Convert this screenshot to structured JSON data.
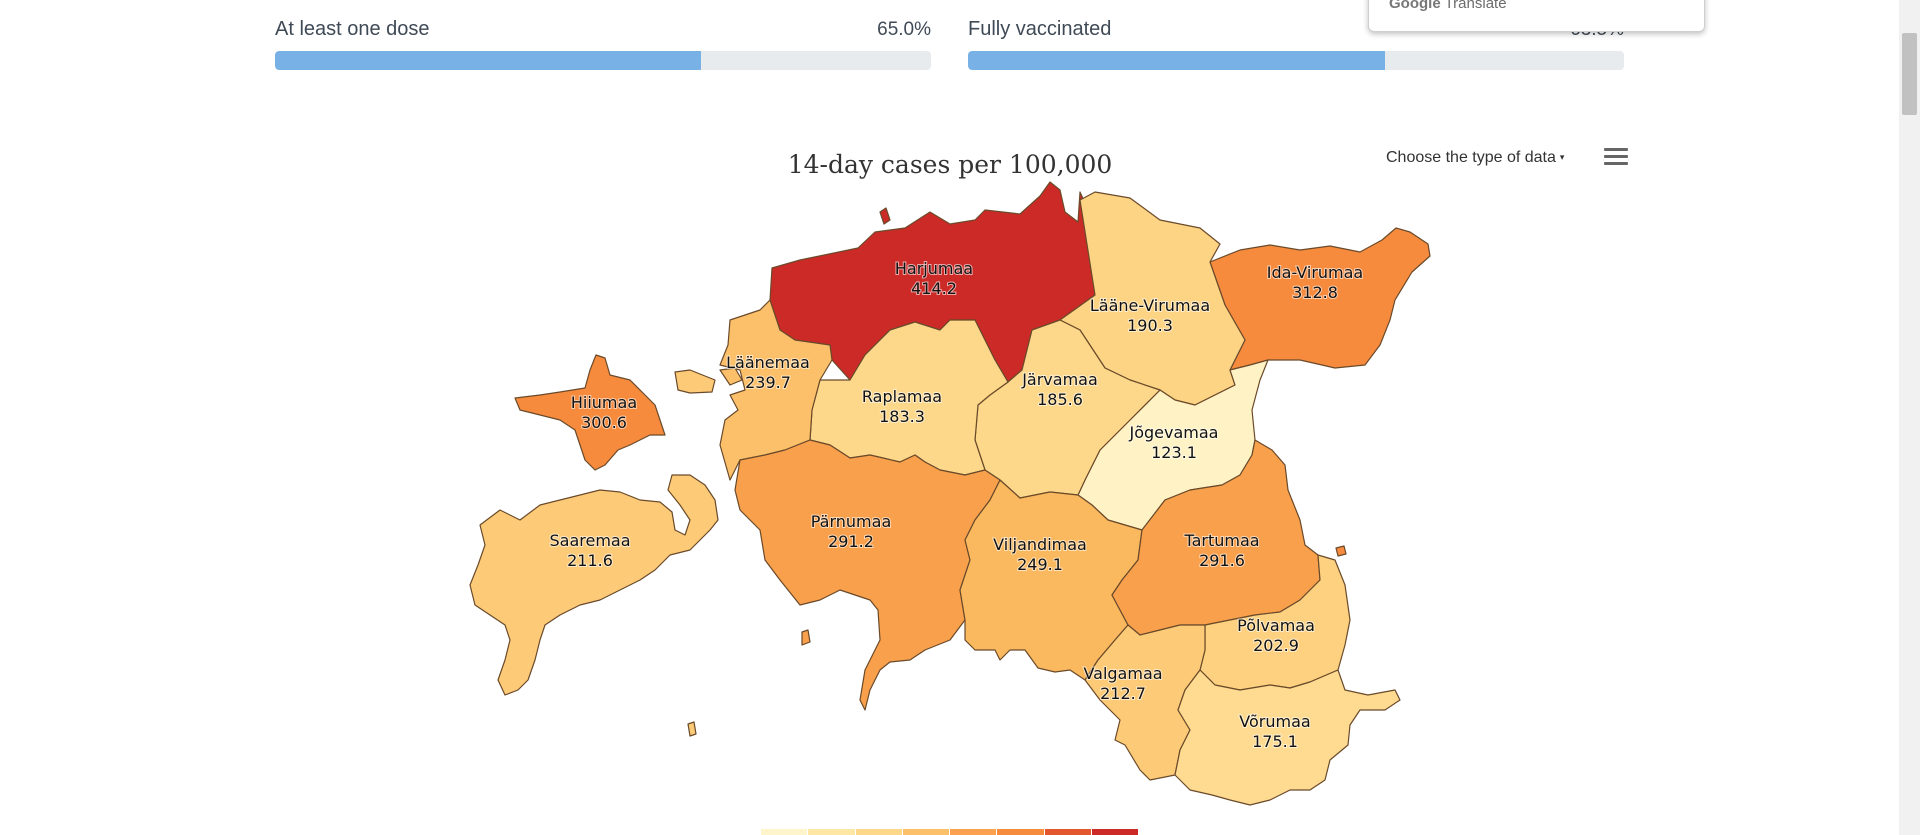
{
  "vaccination": {
    "first": {
      "label": "At least one dose",
      "value_text": "65.0%",
      "fraction": 0.65
    },
    "second": {
      "label": "Fully vaccinated",
      "value_text": "63.5%",
      "fraction": 0.635
    }
  },
  "translate_popup": {
    "brand": "Google",
    "product": "Translate"
  },
  "map": {
    "title": "14-day cases per 100,000",
    "data_selector_label": "Choose the type of data",
    "menu_icon": "hamburger-menu-icon",
    "color_scale": [
      "#fff5cc",
      "#fee7a4",
      "#fdd88a",
      "#fdc06a",
      "#fba14f",
      "#f68b3e",
      "#e3572f",
      "#cc2a27"
    ]
  },
  "regions": [
    {
      "id": "harjumaa",
      "name": "Harjumaa",
      "value": "414.2",
      "color": "#cc2a27"
    },
    {
      "id": "ida-virumaa",
      "name": "Ida-Virumaa",
      "value": "312.8",
      "color": "#f68b3e"
    },
    {
      "id": "laane-virumaa",
      "name": "Lääne-Virumaa",
      "value": "190.3",
      "color": "#fdd484"
    },
    {
      "id": "laanemaa",
      "name": "Läänemaa",
      "value": "239.7",
      "color": "#fdc06a"
    },
    {
      "id": "hiiumaa",
      "name": "Hiiumaa",
      "value": "300.6",
      "color": "#f68b3e"
    },
    {
      "id": "raplamaa",
      "name": "Raplamaa",
      "value": "183.3",
      "color": "#fdd88a"
    },
    {
      "id": "jarvamaa",
      "name": "Järvamaa",
      "value": "185.6",
      "color": "#fdd88a"
    },
    {
      "id": "jogevamaa",
      "name": "Jõgevamaa",
      "value": "123.1",
      "color": "#fff2c4"
    },
    {
      "id": "saaremaa",
      "name": "Saaremaa",
      "value": "211.6",
      "color": "#fdcb78"
    },
    {
      "id": "parnumaa",
      "name": "Pärnumaa",
      "value": "291.2",
      "color": "#f8a04c"
    },
    {
      "id": "viljandimaa",
      "name": "Viljandimaa",
      "value": "249.1",
      "color": "#fbb95f"
    },
    {
      "id": "tartumaa",
      "name": "Tartumaa",
      "value": "291.6",
      "color": "#f8a04c"
    },
    {
      "id": "polvamaa",
      "name": "Põlvamaa",
      "value": "202.9",
      "color": "#fdd180"
    },
    {
      "id": "valgamaa",
      "name": "Valgamaa",
      "value": "212.7",
      "color": "#fdcb78"
    },
    {
      "id": "vorumaa",
      "name": "Võrumaa",
      "value": "175.1",
      "color": "#fedb90"
    }
  ]
}
